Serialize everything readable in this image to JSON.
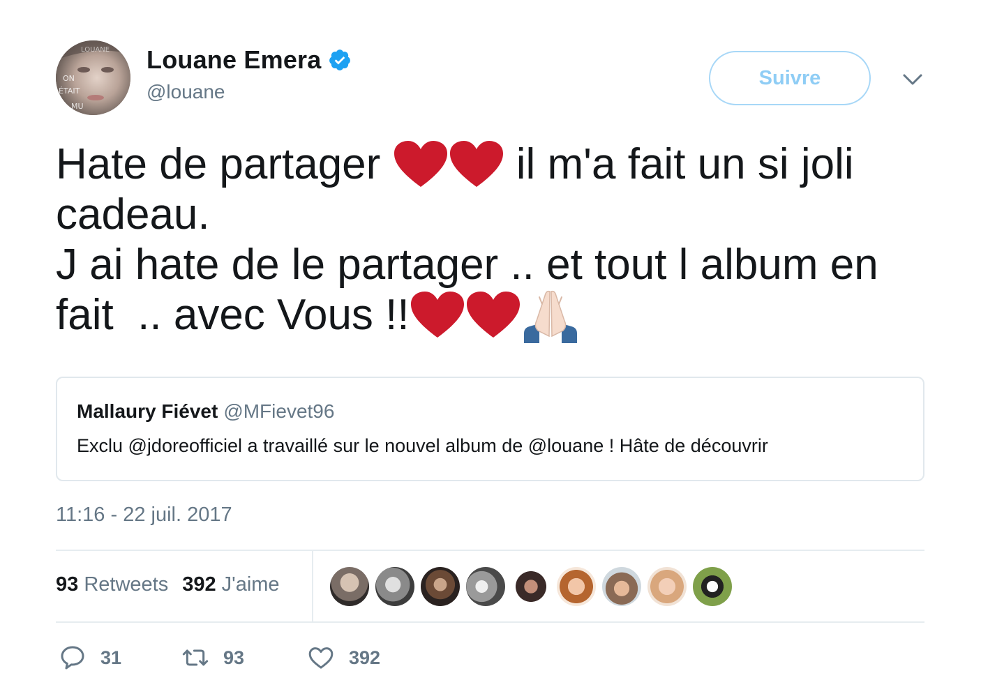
{
  "author": {
    "display_name": "Louane Emera",
    "handle": "@louane",
    "verified": true,
    "avatar_text": [
      "LOUANE",
      "ON",
      "ÉTAIT",
      "MU"
    ]
  },
  "follow_button": {
    "label": "Suivre"
  },
  "tweet": {
    "lines": [
      {
        "before": "Hate de partager ",
        "after": " il m'a fait un si joli"
      },
      {
        "text": "cadeau."
      },
      {
        "text": "J ai hate de le partager .. et tout l album en"
      },
      {
        "text": "fait  .. avec Vous !!"
      }
    ],
    "emoji": [
      "red-heart",
      "red-heart",
      "folded-hands"
    ]
  },
  "quoted_tweet": {
    "display_name": "Mallaury Fiévet",
    "handle": "@MFievet96",
    "text": "Exclu @jdoreofficiel a travaillé sur le nouvel album de @louane ! Hâte de découvrir"
  },
  "timestamp": "11:16 - 22 juil. 2017",
  "stats": {
    "retweets_count": "93",
    "retweets_label": "Retweets",
    "likes_count": "392",
    "likes_label": "J'aime"
  },
  "liker_avatars": 9,
  "actions": {
    "reply_count": "31",
    "retweet_count": "93",
    "like_count": "392"
  },
  "colors": {
    "text": "#14171a",
    "secondary": "#657786",
    "follow_text": "#8fcdf5",
    "follow_border": "#a7d7f7",
    "verified": "#1da1f2",
    "heart": "#cc1a2c",
    "divider": "#e6ecf0"
  },
  "icons": [
    "verified-badge-icon",
    "chevron-down-icon",
    "reply-icon",
    "retweet-icon",
    "like-icon"
  ]
}
